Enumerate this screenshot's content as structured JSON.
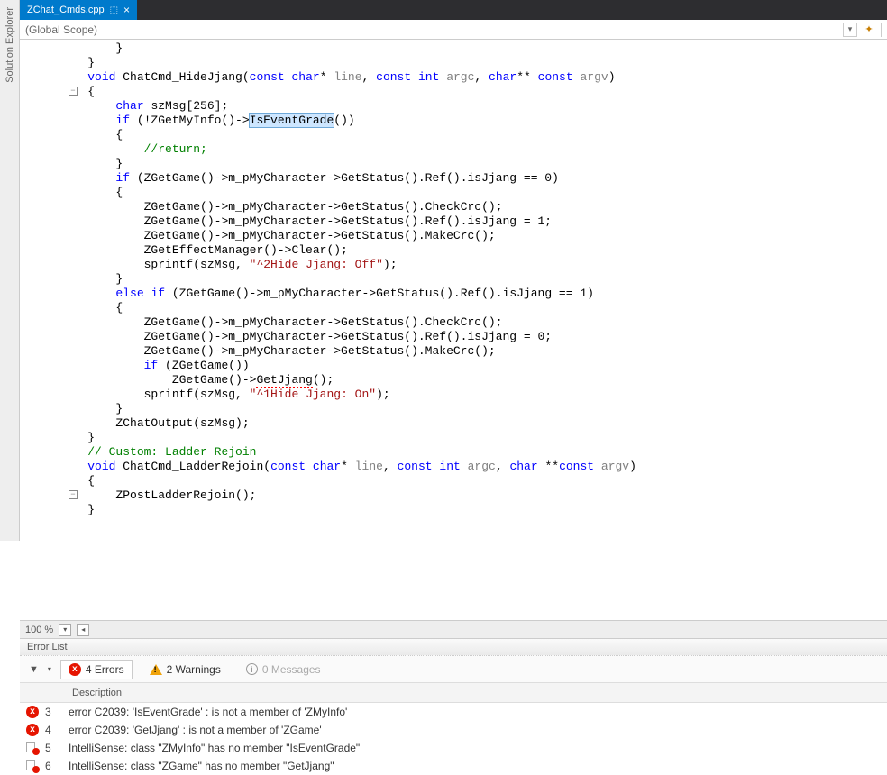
{
  "left_panel": {
    "title": "Solution Explorer"
  },
  "tab": {
    "filename": "ZChat_Cmds.cpp"
  },
  "scope_bar": {
    "scope": "(Global Scope)"
  },
  "code": {
    "lines": [
      {
        "indent": 8,
        "t": [
          {
            "txt": "}"
          }
        ]
      },
      {
        "indent": 4,
        "t": [
          {
            "txt": "}"
          }
        ]
      },
      {
        "blank": true
      },
      {
        "fold": true,
        "indent": 4,
        "t": [
          {
            "cls": "kw",
            "txt": "void"
          },
          {
            "txt": " ChatCmd_HideJjang("
          },
          {
            "cls": "kw",
            "txt": "const"
          },
          {
            "txt": " "
          },
          {
            "cls": "kw",
            "txt": "char"
          },
          {
            "txt": "* "
          },
          {
            "cls": "param",
            "txt": "line"
          },
          {
            "txt": ", "
          },
          {
            "cls": "kw",
            "txt": "const"
          },
          {
            "txt": " "
          },
          {
            "cls": "kw",
            "txt": "int"
          },
          {
            "txt": " "
          },
          {
            "cls": "param",
            "txt": "argc"
          },
          {
            "txt": ", "
          },
          {
            "cls": "kw",
            "txt": "char"
          },
          {
            "txt": "** "
          },
          {
            "cls": "kw",
            "txt": "const"
          },
          {
            "txt": " "
          },
          {
            "cls": "param",
            "txt": "argv"
          },
          {
            "txt": ")"
          }
        ]
      },
      {
        "indent": 4,
        "t": [
          {
            "txt": "{"
          }
        ]
      },
      {
        "indent": 8,
        "t": [
          {
            "cls": "kw",
            "txt": "char"
          },
          {
            "txt": " szMsg[256];"
          }
        ]
      },
      {
        "indent": 8,
        "t": [
          {
            "cls": "kw",
            "txt": "if"
          },
          {
            "txt": " (!ZGetMyInfo()->"
          },
          {
            "cls": "sel",
            "txt": "IsEventGrade"
          },
          {
            "txt": "())"
          }
        ]
      },
      {
        "indent": 8,
        "t": [
          {
            "txt": "{"
          }
        ]
      },
      {
        "indent": 12,
        "t": [
          {
            "cls": "cmt",
            "txt": "//return;"
          }
        ]
      },
      {
        "indent": 8,
        "t": [
          {
            "txt": "}"
          }
        ]
      },
      {
        "indent": 8,
        "t": [
          {
            "cls": "kw",
            "txt": "if"
          },
          {
            "txt": " (ZGetGame()->m_pMyCharacter->GetStatus().Ref().isJjang == 0)"
          }
        ]
      },
      {
        "indent": 8,
        "t": [
          {
            "txt": "{"
          }
        ]
      },
      {
        "indent": 12,
        "t": [
          {
            "txt": "ZGetGame()->m_pMyCharacter->GetStatus().CheckCrc();"
          }
        ]
      },
      {
        "indent": 12,
        "t": [
          {
            "txt": "ZGetGame()->m_pMyCharacter->GetStatus().Ref().isJjang = 1;"
          }
        ]
      },
      {
        "indent": 12,
        "t": [
          {
            "txt": "ZGetGame()->m_pMyCharacter->GetStatus().MakeCrc();"
          }
        ]
      },
      {
        "indent": 12,
        "t": [
          {
            "txt": "ZGetEffectManager()->Clear();"
          }
        ]
      },
      {
        "indent": 12,
        "t": [
          {
            "txt": "sprintf(szMsg, "
          },
          {
            "cls": "str",
            "txt": "\"^2Hide Jjang: Off\""
          },
          {
            "txt": ");"
          }
        ]
      },
      {
        "indent": 8,
        "t": [
          {
            "txt": "}"
          }
        ]
      },
      {
        "indent": 8,
        "t": [
          {
            "cls": "kw",
            "txt": "else"
          },
          {
            "txt": " "
          },
          {
            "cls": "kw",
            "txt": "if"
          },
          {
            "txt": " (ZGetGame()->m_pMyCharacter->GetStatus().Ref().isJjang == 1)"
          }
        ]
      },
      {
        "indent": 8,
        "t": [
          {
            "txt": "{"
          }
        ]
      },
      {
        "indent": 12,
        "t": [
          {
            "txt": "ZGetGame()->m_pMyCharacter->GetStatus().CheckCrc();"
          }
        ]
      },
      {
        "indent": 12,
        "t": [
          {
            "txt": "ZGetGame()->m_pMyCharacter->GetStatus().Ref().isJjang = 0;"
          }
        ]
      },
      {
        "indent": 12,
        "t": [
          {
            "txt": "ZGetGame()->m_pMyCharacter->GetStatus().MakeCrc();"
          }
        ]
      },
      {
        "indent": 12,
        "t": [
          {
            "cls": "kw",
            "txt": "if"
          },
          {
            "txt": " (ZGetGame())"
          }
        ]
      },
      {
        "indent": 16,
        "t": [
          {
            "txt": "ZGetGame()->"
          },
          {
            "cls": "squiggle",
            "txt": "GetJjang"
          },
          {
            "txt": "();"
          }
        ]
      },
      {
        "indent": 12,
        "t": [
          {
            "txt": "sprintf(szMsg, "
          },
          {
            "cls": "str",
            "txt": "\"^1Hide Jjang: On\""
          },
          {
            "txt": ");"
          }
        ]
      },
      {
        "indent": 8,
        "t": [
          {
            "txt": "}"
          }
        ]
      },
      {
        "indent": 8,
        "t": [
          {
            "txt": "ZChatOutput(szMsg);"
          }
        ]
      },
      {
        "indent": 4,
        "t": [
          {
            "txt": "}"
          }
        ]
      },
      {
        "blank": true
      },
      {
        "indent": 4,
        "t": [
          {
            "cls": "cmt",
            "txt": "// Custom: Ladder Rejoin"
          }
        ]
      },
      {
        "fold": true,
        "indent": 4,
        "t": [
          {
            "cls": "kw",
            "txt": "void"
          },
          {
            "txt": " ChatCmd_LadderRejoin("
          },
          {
            "cls": "kw",
            "txt": "const"
          },
          {
            "txt": " "
          },
          {
            "cls": "kw",
            "txt": "char"
          },
          {
            "txt": "* "
          },
          {
            "cls": "param",
            "txt": "line"
          },
          {
            "txt": ", "
          },
          {
            "cls": "kw",
            "txt": "const"
          },
          {
            "txt": " "
          },
          {
            "cls": "kw",
            "txt": "int"
          },
          {
            "txt": " "
          },
          {
            "cls": "param",
            "txt": "argc"
          },
          {
            "txt": ", "
          },
          {
            "cls": "kw",
            "txt": "char"
          },
          {
            "txt": " **"
          },
          {
            "cls": "kw",
            "txt": "const"
          },
          {
            "txt": " "
          },
          {
            "cls": "param",
            "txt": "argv"
          },
          {
            "txt": ")"
          }
        ]
      },
      {
        "indent": 4,
        "t": [
          {
            "txt": "{"
          }
        ]
      },
      {
        "indent": 8,
        "t": [
          {
            "txt": "ZPostLadderRejoin();"
          }
        ]
      },
      {
        "indent": 4,
        "t": [
          {
            "txt": "}"
          }
        ]
      }
    ]
  },
  "zoom": {
    "value": "100 %"
  },
  "error_list": {
    "title": "Error List",
    "filters": {
      "errors_label": "4 Errors",
      "warnings_label": "2 Warnings",
      "messages_label": "0 Messages"
    },
    "header": {
      "description": "Description"
    },
    "rows": [
      {
        "kind": "error",
        "num": "3",
        "desc": "error C2039: 'IsEventGrade' : is not a member of 'ZMyInfo'"
      },
      {
        "kind": "error",
        "num": "4",
        "desc": "error C2039: 'GetJjang' : is not a member of 'ZGame'"
      },
      {
        "kind": "intelli",
        "num": "5",
        "desc": "IntelliSense: class \"ZMyInfo\" has no member \"IsEventGrade\""
      },
      {
        "kind": "intelli",
        "num": "6",
        "desc": "IntelliSense: class \"ZGame\" has no member \"GetJjang\""
      }
    ]
  }
}
